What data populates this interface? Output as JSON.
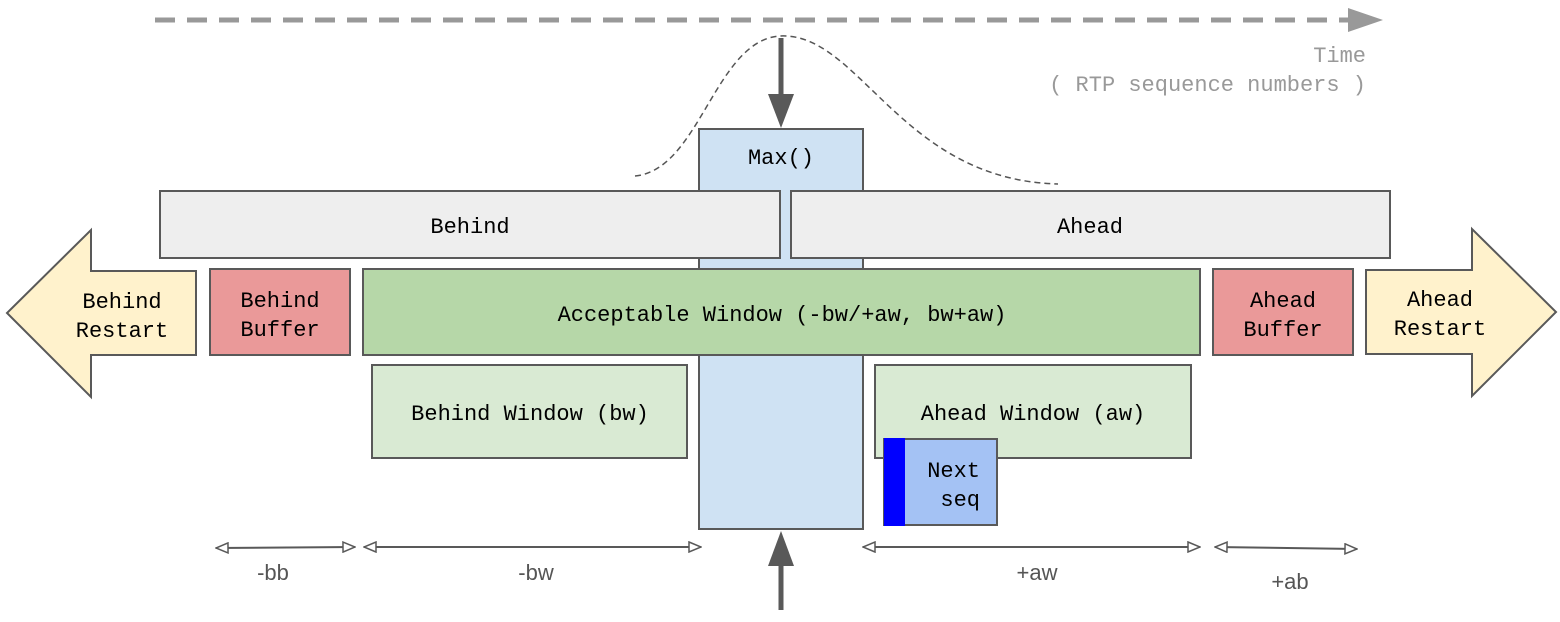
{
  "time_axis": {
    "label": "Time",
    "sublabel": "( RTP sequence numbers )"
  },
  "boxes": {
    "max": "Max()",
    "behind": "Behind",
    "ahead": "Ahead",
    "acceptable_window": "Acceptable Window (-bw/+aw, bw+aw)",
    "behind_buffer": [
      "Behind",
      "Buffer"
    ],
    "ahead_buffer": [
      "Ahead",
      "Buffer"
    ],
    "behind_restart": [
      "Behind",
      "Restart"
    ],
    "ahead_restart": [
      "Ahead",
      "Restart"
    ],
    "behind_window": "Behind Window (bw)",
    "ahead_window": "Ahead Window (aw)",
    "next_seq": [
      "Next",
      "seq"
    ]
  },
  "dimensions": {
    "bb": "-bb",
    "bw": "-bw",
    "aw": "+aw",
    "ab": "+ab"
  },
  "colors": {
    "max": "#cfe2f3",
    "bar": "#eeeeee",
    "window": "#b6d7a8",
    "subwindow": "#d9ead3",
    "buffer": "#ea9999",
    "restart": "#fff2cc",
    "next": "#a4c2f4",
    "marker": "#0000ff"
  }
}
